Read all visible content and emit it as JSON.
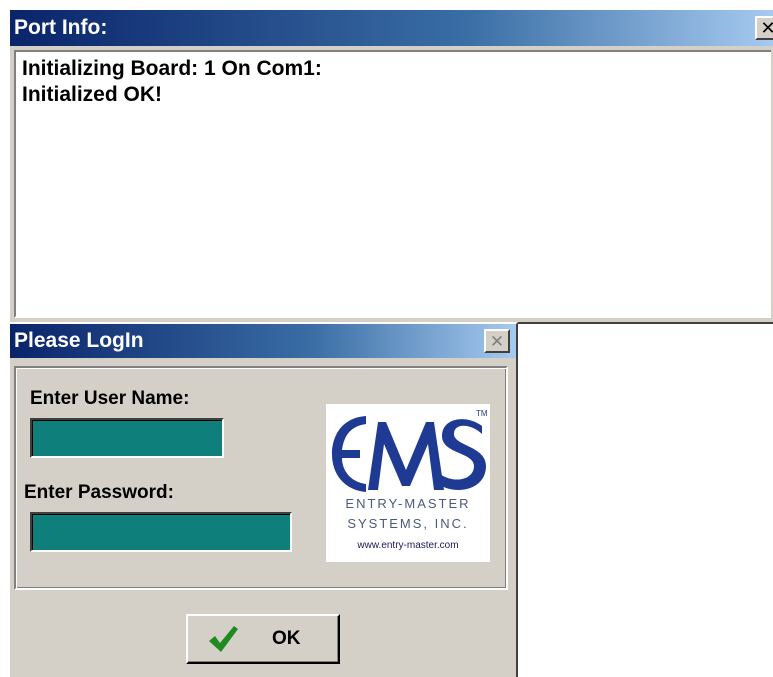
{
  "port_info": {
    "title": "Port Info:",
    "close_glyph": "✕",
    "lines": "Initializing Board: 1 On Com1:\nInitialized OK!"
  },
  "login": {
    "title": "Please LogIn",
    "close_glyph": "✕",
    "username_label": "Enter User Name:",
    "username_value": "",
    "password_label": "Enter Password:",
    "password_value": "",
    "ok_label": "OK",
    "ok_icon": "check-icon"
  },
  "logo": {
    "mark": "EMS",
    "tm": "TM",
    "company_line1": "ENTRY-MASTER",
    "company_line2": "SYSTEMS, INC.",
    "url": "www.entry-master.com"
  },
  "colors": {
    "titlebar_start": "#0a246a",
    "titlebar_end": "#a6caf0",
    "field_teal": "#0e7f7a",
    "logo_blue": "#1f3a93",
    "check_green": "#1f8a1f"
  }
}
